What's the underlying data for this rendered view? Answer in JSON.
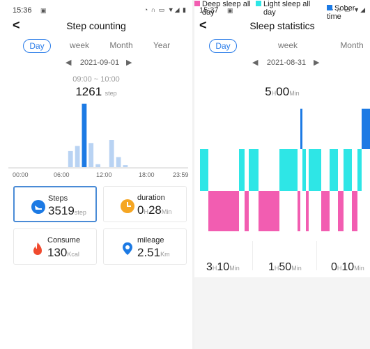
{
  "left": {
    "status": {
      "time": "15:36",
      "sim": "▣",
      "icons": "◔ ∩ ▭ ▼◢ ▮"
    },
    "back": "<",
    "title": "Step counting",
    "tabs": [
      "Day",
      "week",
      "Month",
      "Year"
    ],
    "active_tab": "Day",
    "date_prev": "◀",
    "date": "2021-09-01",
    "date_next": "▶",
    "time_range": "09:00 ~ 10:00",
    "selected_value": "1261",
    "selected_unit": "step",
    "chart_data": {
      "type": "bar",
      "x_ticks": [
        "00:00",
        "06:00",
        "12:00",
        "18:00",
        "23:59"
      ],
      "hours": [
        0,
        1,
        2,
        3,
        4,
        5,
        6,
        7,
        8,
        9,
        10,
        11,
        12,
        13,
        14,
        15,
        16,
        17,
        18,
        19,
        20,
        21,
        22,
        23
      ],
      "values": [
        0,
        0,
        0,
        0,
        0,
        0,
        0,
        320,
        420,
        1261,
        480,
        60,
        0,
        540,
        200,
        40,
        0,
        0,
        0,
        0,
        0,
        0,
        0,
        0
      ],
      "highlighted_hour": 9,
      "ylim": [
        0,
        1300
      ],
      "colors": {
        "bar": "#b9d3f3",
        "highlight": "#1c7ae4",
        "axis": "#cccccc"
      }
    },
    "cards": [
      {
        "label": "Steps",
        "value": "3519",
        "unit": "step",
        "icon": "shoe-icon",
        "selected": true
      },
      {
        "label": "duration",
        "value_h": "0",
        "unit_h": "H",
        "value_m": "28",
        "unit_m": "Min",
        "icon": "clock-icon"
      },
      {
        "label": "Consume",
        "value": "130",
        "unit": "Kcal",
        "icon": "flame-icon"
      },
      {
        "label": "mileage",
        "value": "2.51",
        "unit": "Km",
        "icon": "location-pin-icon"
      }
    ]
  },
  "right": {
    "status": {
      "time": "15:37",
      "sim": "▣",
      "icons": "◔ ∩ ▭ ▼◢"
    },
    "back": "<",
    "title": "Sleep statistics",
    "tabs": [
      "Day",
      "week",
      "Month"
    ],
    "active_tab": "Day",
    "date_prev": "◀",
    "date": "2021-08-31",
    "date_next": "▶",
    "total_h": "5",
    "total_h_unit": "H",
    "total_m": "00",
    "total_m_unit": "Min",
    "chart_data": {
      "type": "bar",
      "segments_note": "sleep stage timeline",
      "colors": {
        "deep": "#f25db1",
        "light": "#2ee6e6",
        "sober": "#1c7ae4"
      },
      "legend": [
        {
          "label": "Deep sleep all day",
          "h": "3",
          "m": "10"
        },
        {
          "label": "Light sleep all day",
          "h": "1",
          "m": "50"
        },
        {
          "label": "Sober time",
          "h": "0",
          "m": "10"
        }
      ]
    },
    "units": {
      "h": "H",
      "m": "Min"
    }
  }
}
